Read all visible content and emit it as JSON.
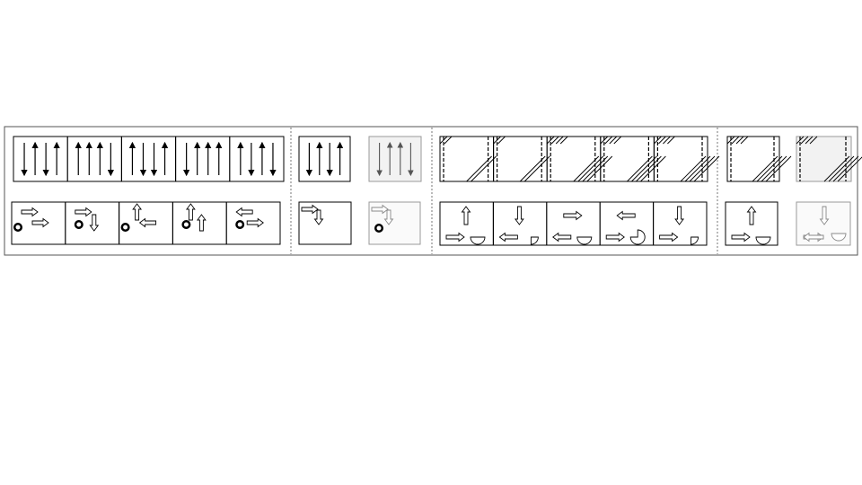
{
  "figure": {
    "sections": [
      {
        "name": "vertical-arrows-and-movement-examples"
      },
      {
        "name": "single-panel-original-and-noisy"
      },
      {
        "name": "hatched-panels-and-shape-examples"
      },
      {
        "name": "single-hatched-original-and-noisy"
      }
    ],
    "section1": {
      "arrow_panels": [
        [
          "down",
          "up",
          "down",
          "up"
        ],
        [
          "up",
          "up",
          "up",
          "down"
        ],
        [
          "up",
          "down",
          "down",
          "up"
        ],
        [
          "down",
          "up",
          "up",
          "up"
        ],
        [
          "up",
          "down",
          "up",
          "down"
        ]
      ],
      "move_cells": [
        {
          "top": "right",
          "bottom": "right",
          "token": "bottom-left"
        },
        {
          "top": "right",
          "bottom": "down",
          "token": "middle"
        },
        {
          "top": "up",
          "bottom": "left",
          "token": "bottom-left"
        },
        {
          "top": "up",
          "bottom": "up",
          "token": "middle"
        },
        {
          "top": "left",
          "bottom": "right",
          "token": "middle"
        }
      ]
    },
    "section2": {
      "arrow_panel": [
        "down",
        "up",
        "down",
        "up"
      ],
      "noisy_arrow_panel": [
        "down",
        "up",
        "up",
        "down"
      ]
    },
    "section3": {
      "hatched_panel_count": 5,
      "shape_cells": [
        {
          "top": "up",
          "bottom_arrow": "right",
          "shape": "half-disc"
        },
        {
          "top": "down",
          "bottom_arrow": "left",
          "shape": "quarter-disc"
        },
        {
          "top": "right",
          "bottom_arrow": "left",
          "shape": "half-disc"
        },
        {
          "top": "left",
          "bottom_arrow": "right",
          "shape": "three-quarter-disc"
        },
        {
          "top": "down",
          "bottom_arrow": "right",
          "shape": "quarter-disc"
        }
      ]
    },
    "section4": {
      "shape_cell": {
        "top": "up",
        "bottom_arrow": "right",
        "shape": "half-disc"
      },
      "noisy_shape_cell": {
        "top": "down",
        "bottom_arrow": "double",
        "shape": "half-disc"
      }
    }
  }
}
